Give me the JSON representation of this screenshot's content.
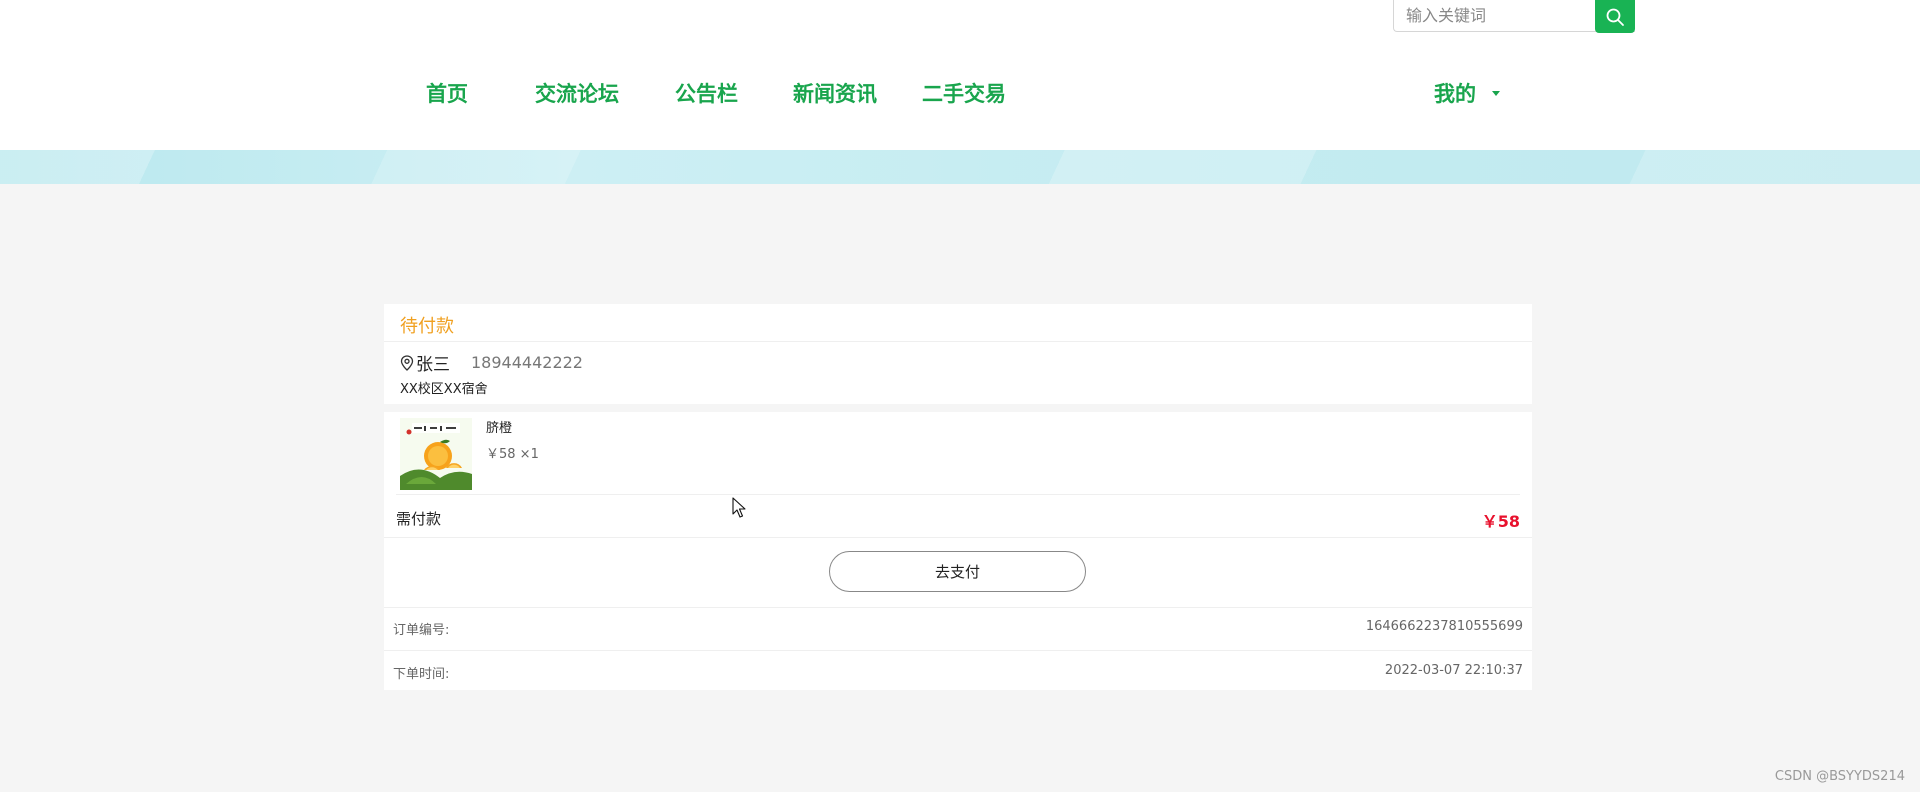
{
  "header": {
    "search": {
      "placeholder": "输入关键词",
      "value": ""
    },
    "nav": {
      "home": "首页",
      "forum": "交流论坛",
      "notice": "公告栏",
      "news": "新闻资讯",
      "market": "二手交易",
      "mine": "我的"
    }
  },
  "order": {
    "status": "待付款",
    "address": {
      "name": "张三",
      "phone": "18944442222",
      "detail": "XX校区XX宿舍"
    },
    "product": {
      "name": "脐橙",
      "price_qty": "￥58 ×1",
      "image_icon": "orange-product-image"
    },
    "pay_label": "需付款",
    "pay_amount": "￥58",
    "pay_button": "去支付",
    "order_no_label": "订单编号:",
    "order_no": "1646662237810555699",
    "time_label": "下单时间:",
    "time": "2022-03-07 22:10:37"
  },
  "watermark": "CSDN @BSYYDS214",
  "colors": {
    "brand_green": "#19b354",
    "status_orange": "#f0a020",
    "price_red": "#e8112d"
  }
}
